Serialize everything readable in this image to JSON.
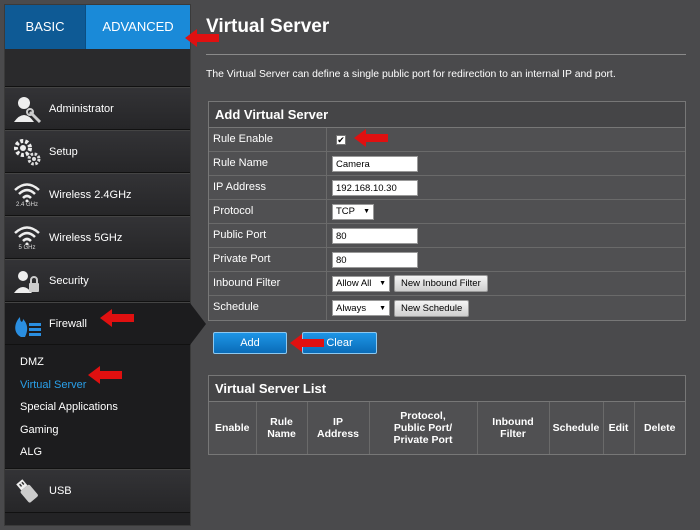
{
  "tabs": {
    "basic": "BASIC",
    "advanced": "ADVANCED"
  },
  "sidebar": {
    "items": [
      {
        "label": "Administrator"
      },
      {
        "label": "Setup"
      },
      {
        "label": "Wireless 2.4GHz",
        "icon_caption": "2.4 GHz"
      },
      {
        "label": "Wireless 5GHz",
        "icon_caption": "5 GHz"
      },
      {
        "label": "Security"
      },
      {
        "label": "Firewall"
      },
      {
        "label": "USB"
      }
    ],
    "firewall_sub": [
      "DMZ",
      "Virtual Server",
      "Special Applications",
      "Gaming",
      "ALG"
    ]
  },
  "page": {
    "title": "Virtual Server",
    "description": "The Virtual Server can define a single public port for redirection to an internal IP and port."
  },
  "add_form": {
    "heading": "Add Virtual Server",
    "labels": {
      "rule_enable": "Rule Enable",
      "rule_name": "Rule Name",
      "ip_address": "IP Address",
      "protocol": "Protocol",
      "public_port": "Public Port",
      "private_port": "Private Port",
      "inbound_filter": "Inbound Filter",
      "schedule": "Schedule"
    },
    "values": {
      "rule_enable_mark": "✔",
      "rule_name": "Camera",
      "ip_address": "192.168.10.30",
      "protocol": "TCP",
      "public_port": "80",
      "private_port": "80",
      "inbound_filter": "Allow All",
      "schedule": "Always"
    },
    "new_inbound_filter_label": "New Inbound Filter",
    "new_schedule_label": "New Schedule",
    "add_label": "Add",
    "clear_label": "Clear"
  },
  "list": {
    "heading": "Virtual Server List",
    "columns": [
      "Enable",
      "Rule\nName",
      "IP\nAddress",
      "Protocol,\nPublic Port/\nPrivate Port",
      "Inbound\nFilter",
      "Schedule",
      "Edit",
      "Delete"
    ]
  },
  "colors": {
    "accent": "#1a8ad8",
    "highlight_text": "#2aa0ea",
    "annotation": "#e01010"
  }
}
